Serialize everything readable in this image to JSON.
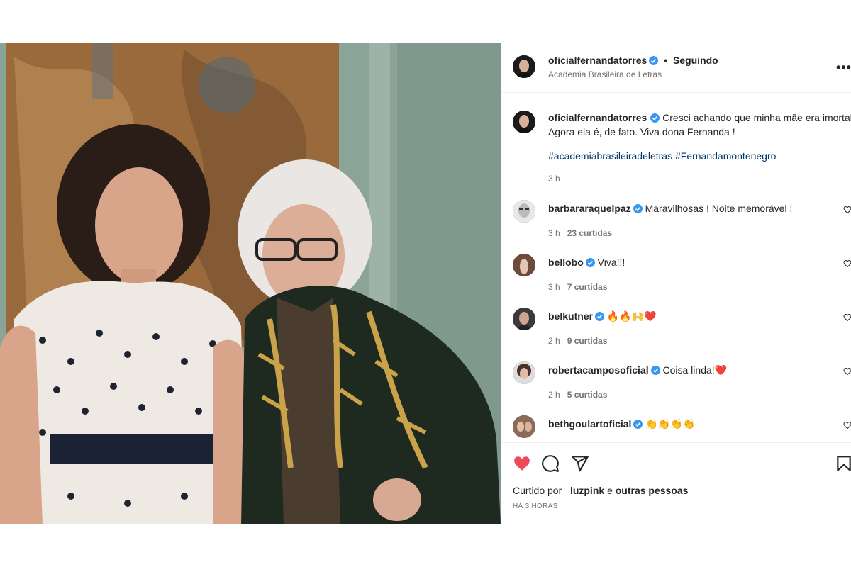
{
  "post": {
    "photo_alt": "",
    "header": {
      "username": "oficialfernandatorres",
      "separator": "•",
      "follow_status": "Seguindo",
      "location": "Academia Brasileira de Letras",
      "more_icon": "more-horizontal-icon"
    },
    "caption": {
      "username": "oficialfernandatorres",
      "text": "Cresci achando que minha mãe era imortal. Agora ela é, de fato. Viva dona Fernanda !",
      "hashtags": "#academiabrasileiradeletras #Fernandamontenegro",
      "time": "3 h"
    },
    "comments": [
      {
        "username": "barbararaquelpaz",
        "text": "Maravilhosas ! Noite memorável !",
        "time": "3 h",
        "likes": "23 curtidas"
      },
      {
        "username": "bellobo",
        "text": "Viva!!!",
        "time": "3 h",
        "likes": "7 curtidas"
      },
      {
        "username": "belkutner",
        "text": "🔥🔥🙌❤️",
        "time": "2 h",
        "likes": "9 curtidas"
      },
      {
        "username": "robertacamposoficial",
        "text": "Coisa linda!❤️",
        "time": "2 h",
        "likes": "5 curtidas"
      },
      {
        "username": "bethgoulartoficial",
        "text": "👏👏👏👏",
        "time": "",
        "likes": ""
      }
    ],
    "actions": {
      "like_icon": "heart-filled-icon",
      "comment_icon": "comment-icon",
      "share_icon": "send-icon",
      "save_icon": "bookmark-icon",
      "liked_by_prefix": "Curtido por",
      "liked_by_user": "_luzpink",
      "liked_by_connector": "e",
      "liked_by_others": "outras pessoas",
      "posted_time": "HÁ 3 HORAS"
    }
  },
  "colors": {
    "verified": "#3897f0",
    "like_red": "#ed4956",
    "link": "#00376b",
    "muted": "#737373"
  }
}
